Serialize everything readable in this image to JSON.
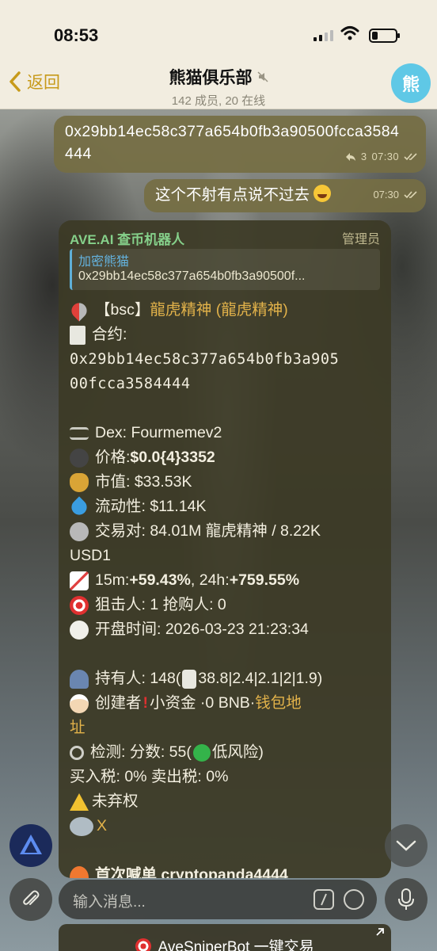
{
  "status_bar": {
    "time": "08:53"
  },
  "header": {
    "back_label": "返回",
    "title": "熊猫俱乐部",
    "subtitle": "142 成员, 20 在线",
    "avatar_text": "熊"
  },
  "messages": {
    "out1": {
      "text": "0x29bb14ec58c377a654b0fb3a90500fcca3584444",
      "reply_count": "3",
      "time": "07:30"
    },
    "out2": {
      "text": "这个不射有点说不过去",
      "time": "07:30"
    }
  },
  "bot_message": {
    "sender": "AVE.AI 查币机器人",
    "role": "管理员",
    "reply_name": "加密熊猫",
    "reply_text": "0x29bb14ec58c377a654b0fb3a90500f...",
    "chain_prefix": "【bsc】",
    "token_name": "龍虎精神 (龍虎精神)",
    "contract_label": "合约:",
    "contract_line1": "0x29bb14ec58c377a654b0fb3a905",
    "contract_line2": "00fcca3584444",
    "dex": "Dex: Fourmemev2",
    "price_label": "价格: ",
    "price_value": "$0.0{4}3352",
    "mcap": "市值: $33.53K",
    "liquidity": "流动性: $11.14K",
    "pair_line1": "交易对: 84.01M 龍虎精神 / 8.22K",
    "pair_line2": "USD1",
    "change_15m_label": "15m: ",
    "change_15m": "+59.43%",
    "change_24h_label": ", 24h: ",
    "change_24h": "+759.55%",
    "snipers": "狙击人: 1  抢购人: 0",
    "open_time": "开盘时间: 2026-03-23 21:23:34",
    "holders": "持有人: 148(",
    "holders_tail": "38.8|2.4|2.1|2|1.9)",
    "creator_label": "创建者 ",
    "creator_mid": " 小资金 ·0 BNB· ",
    "creator_link1": "钱包地",
    "creator_link2": "址",
    "check": "检测: 分数: 55(",
    "check_tail": "低风险)",
    "tax": "买入税: 0%  卖出税: 0%",
    "renounce": "未弃权",
    "x_link": "X",
    "last_line": "首次喊单 cryptopanda4444"
  },
  "input": {
    "placeholder": "输入消息..."
  },
  "keyboard_button": {
    "label": "AveSniperBot 一键交易"
  }
}
